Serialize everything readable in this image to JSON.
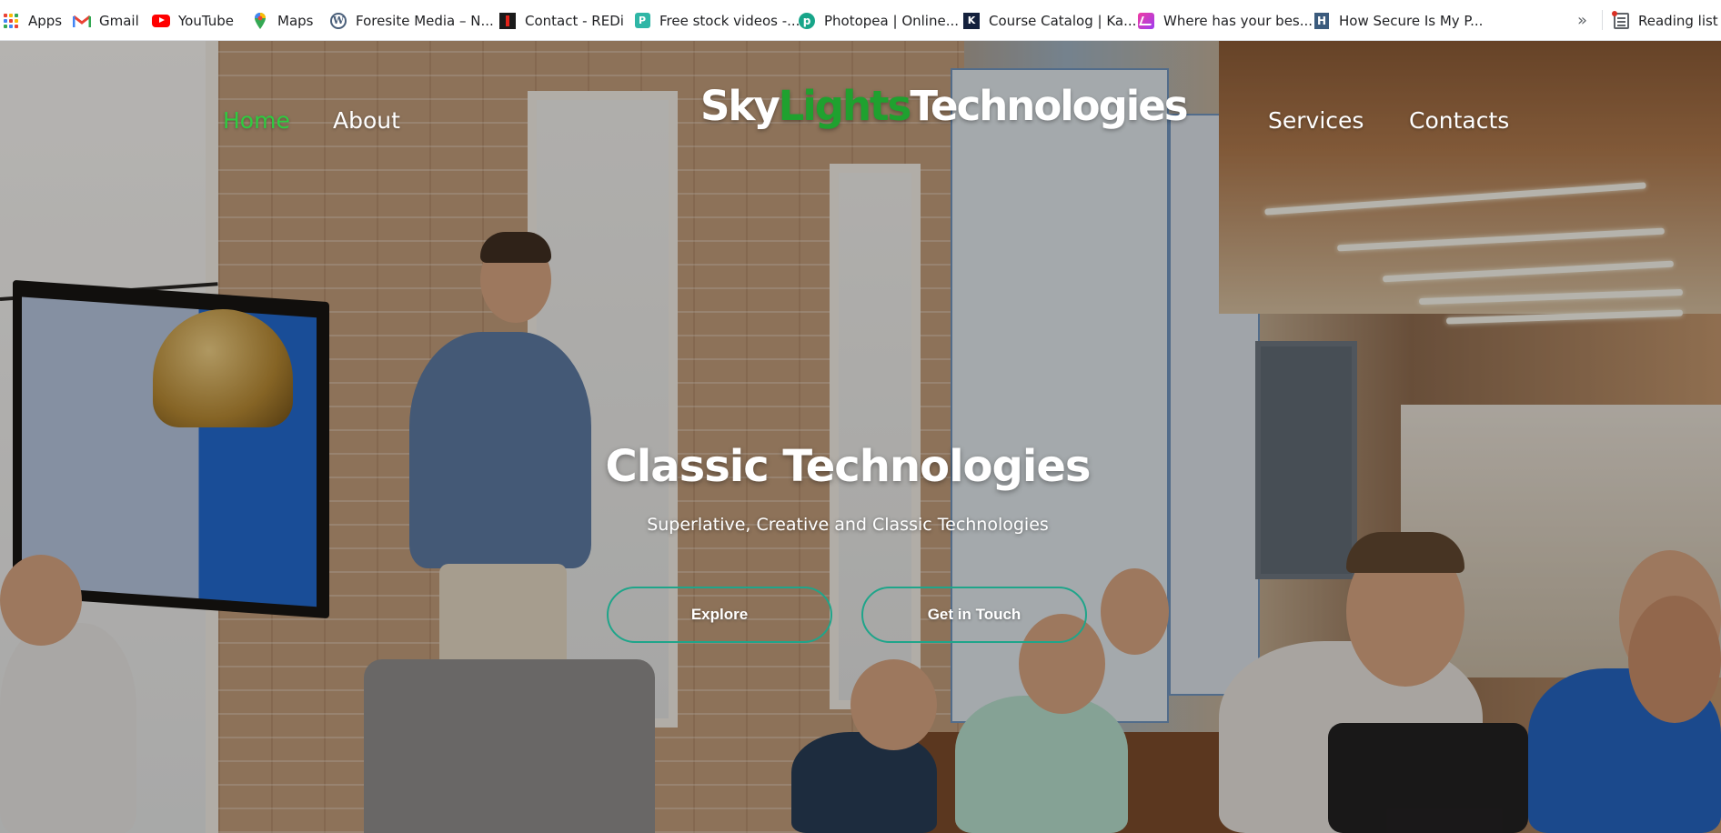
{
  "bookmarks": [
    {
      "label": "Apps",
      "icon": "apps-grid-icon"
    },
    {
      "label": "Gmail",
      "icon": "gmail-icon"
    },
    {
      "label": "YouTube",
      "icon": "youtube-icon"
    },
    {
      "label": "Maps",
      "icon": "maps-icon"
    },
    {
      "label": "Foresite Media – N...",
      "icon": "wordpress-icon"
    },
    {
      "label": "Contact - REDi",
      "icon": "redi-icon"
    },
    {
      "label": "Free stock videos -...",
      "icon": "stock-videos-icon"
    },
    {
      "label": "Photopea | Online...",
      "icon": "photopea-icon"
    },
    {
      "label": "Course Catalog | Ka...",
      "icon": "course-catalog-icon"
    },
    {
      "label": "Where has your bes...",
      "icon": "music-icon"
    },
    {
      "label": "How Secure Is My P...",
      "icon": "how-secure-icon"
    }
  ],
  "bookmarks_overflow": "»",
  "reading_list": "Reading list",
  "site": {
    "nav": {
      "home": "Home",
      "about": "About",
      "services": "Services",
      "contacts": "Contacts"
    },
    "logo": {
      "part1": "Sky",
      "part2": "Lights",
      "part3": "Technologies"
    },
    "hero": {
      "title": "Classic Technologies",
      "subtitle": "Superlative, Creative and Classic Technologies",
      "explore_button": "Explore",
      "contact_button": "Get in Touch"
    }
  },
  "colors": {
    "nav_active": "#2ecc40",
    "logo_accent": "#1fa12f",
    "button_border": "#1fa58a"
  }
}
